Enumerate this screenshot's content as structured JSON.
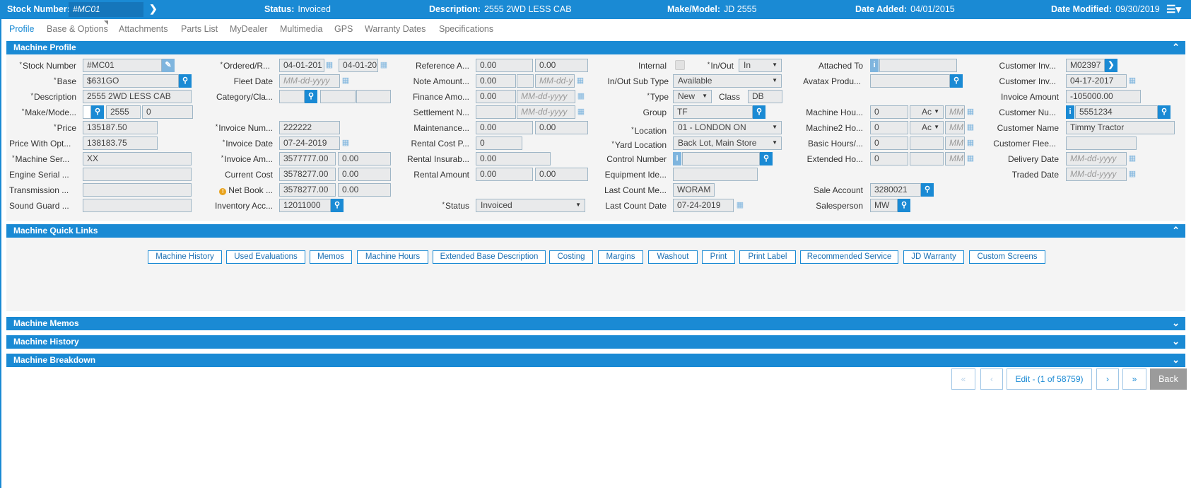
{
  "header": {
    "stock_label": "Stock Number:",
    "stock_value": "#MC01",
    "status_label": "Status:",
    "status_value": "Invoiced",
    "desc_label": "Description:",
    "desc_value": "2555 2WD LESS CAB",
    "make_label": "Make/Model:",
    "make_value": "JD 2555",
    "added_label": "Date Added:",
    "added_value": "04/01/2015",
    "modified_label": "Date Modified:",
    "modified_value": "09/30/2019"
  },
  "tabs": [
    "Profile",
    "Base & Options",
    "Attachments",
    "Parts List",
    "MyDealer",
    "Multimedia",
    "GPS",
    "Warranty Dates",
    "Specifications"
  ],
  "sections": {
    "profile": "Machine Profile",
    "quick_links": "Machine Quick Links",
    "memos": "Machine Memos",
    "history": "Machine History",
    "breakdown": "Machine Breakdown"
  },
  "col1": {
    "stock_number": {
      "label": "Stock Number",
      "value": "#MC01"
    },
    "base": {
      "label": "Base",
      "value": "$631GO"
    },
    "description": {
      "label": "Description",
      "value": "2555 2WD LESS CAB"
    },
    "make_model": {
      "label": "Make/Mode...",
      "v1": "2555",
      "v2": "0"
    },
    "price": {
      "label": "Price",
      "value": "135187.50"
    },
    "price_opt": {
      "label": "Price With Opt...",
      "value": "138183.75"
    },
    "machine_serial": {
      "label": "Machine Ser...",
      "value": "XX"
    },
    "engine_serial": {
      "label": "Engine Serial ...",
      "value": ""
    },
    "transmission": {
      "label": "Transmission ...",
      "value": ""
    },
    "sound_guard": {
      "label": "Sound Guard ...",
      "value": ""
    }
  },
  "col2": {
    "ordered": {
      "label": "Ordered/R...",
      "v1": "04-01-201",
      "v2": "04-01-20"
    },
    "fleet_date": {
      "label": "Fleet Date",
      "placeholder": "MM-dd-yyyy"
    },
    "category": {
      "label": "Category/Cla..."
    },
    "invoice_num": {
      "label": "Invoice Num...",
      "value": "222222"
    },
    "invoice_date": {
      "label": "Invoice Date",
      "value": "07-24-2019"
    },
    "invoice_amt": {
      "label": "Invoice Am...",
      "v1": "3577777.00",
      "v2": "0.00"
    },
    "current_cost": {
      "label": "Current Cost",
      "v1": "3578277.00",
      "v2": "0.00"
    },
    "net_book": {
      "label": "Net Book ...",
      "v1": "3578277.00",
      "v2": "0.00"
    },
    "inventory_acc": {
      "label": "Inventory Acc...",
      "value": "12011000"
    }
  },
  "col3": {
    "reference": {
      "label": "Reference A...",
      "v1": "0.00",
      "v2": "0.00"
    },
    "note_amount": {
      "label": "Note Amount...",
      "v1": "0.00",
      "v2": "MM-dd-y"
    },
    "finance": {
      "label": "Finance Amo...",
      "v1": "0.00",
      "v2": "MM-dd-yyyy"
    },
    "settlement": {
      "label": "Settlement N...",
      "v2": "MM-dd-yyyy"
    },
    "maintenance": {
      "label": "Maintenance...",
      "v1": "0.00",
      "v2": "0.00"
    },
    "rental_cost": {
      "label": "Rental Cost P...",
      "value": "0"
    },
    "rental_ins": {
      "label": "Rental Insurab...",
      "value": "0.00"
    },
    "rental_amount": {
      "label": "Rental Amount",
      "v1": "0.00",
      "v2": "0.00"
    },
    "status": {
      "label": "Status",
      "value": "Invoiced"
    }
  },
  "col4": {
    "internal": {
      "label": "Internal"
    },
    "in_out": {
      "label": "In/Out",
      "value": "In"
    },
    "in_out_sub": {
      "label": "In/Out Sub Type",
      "value": "Available"
    },
    "type": {
      "label": "Type",
      "value": "New"
    },
    "class": {
      "label": "Class",
      "value": "DB"
    },
    "group": {
      "label": "Group",
      "value": "TF"
    },
    "location": {
      "label": "Location",
      "value": "01 - LONDON ON"
    },
    "yard": {
      "label": "Yard Location",
      "value": "Back Lot, Main Store"
    },
    "control": {
      "label": "Control Number",
      "value": ""
    },
    "equipment": {
      "label": "Equipment Ide...",
      "value": ""
    },
    "last_count_me": {
      "label": "Last Count Me...",
      "value": "WORAM"
    },
    "last_count_date": {
      "label": "Last Count Date",
      "value": "07-24-2019"
    }
  },
  "col5": {
    "attached": {
      "label": "Attached To"
    },
    "avatax": {
      "label": "Avatax Produ..."
    },
    "machine_hours": {
      "label": "Machine Hou...",
      "v1": "0",
      "v2": "Ac",
      "v3": "MM"
    },
    "machine2_hours": {
      "label": "Machine2 Ho...",
      "v1": "0",
      "v2": "Ac",
      "v3": "MM"
    },
    "basic_hours": {
      "label": "Basic Hours/...",
      "v1": "0",
      "v3": "MM"
    },
    "extended_hours": {
      "label": "Extended Ho...",
      "v1": "0",
      "v3": "MM"
    },
    "sale_account": {
      "label": "Sale Account",
      "value": "3280021"
    },
    "salesperson": {
      "label": "Salesperson",
      "value": "MW"
    }
  },
  "col6": {
    "customer_inv1": {
      "label": "Customer Inv...",
      "value": "M02397"
    },
    "customer_inv2": {
      "label": "Customer Inv...",
      "value": "04-17-2017"
    },
    "invoice_amount": {
      "label": "Invoice Amount",
      "value": "-105000.00"
    },
    "customer_num": {
      "label": "Customer Nu...",
      "value": "5551234"
    },
    "customer_name": {
      "label": "Customer Name",
      "value": "Timmy Tractor"
    },
    "customer_fleet": {
      "label": "Customer Flee..."
    },
    "delivery_date": {
      "label": "Delivery Date",
      "placeholder": "MM-dd-yyyy"
    },
    "traded_date": {
      "label": "Traded Date",
      "placeholder": "MM-dd-yyyy"
    }
  },
  "quick_links": [
    "Machine History",
    "Used Evaluations",
    "Memos",
    "Machine Hours",
    "Extended Base Description",
    "Costing",
    "Margins",
    "Washout",
    "Print",
    "Print Label",
    "Recommended Service",
    "JD Warranty",
    "Custom Screens"
  ],
  "pager": {
    "first": "«",
    "prev": "‹",
    "edit": "Edit - (1 of 58759)",
    "next": "›",
    "last": "»",
    "back": "Back"
  },
  "colors": {
    "accent": "#1a8ad4"
  }
}
